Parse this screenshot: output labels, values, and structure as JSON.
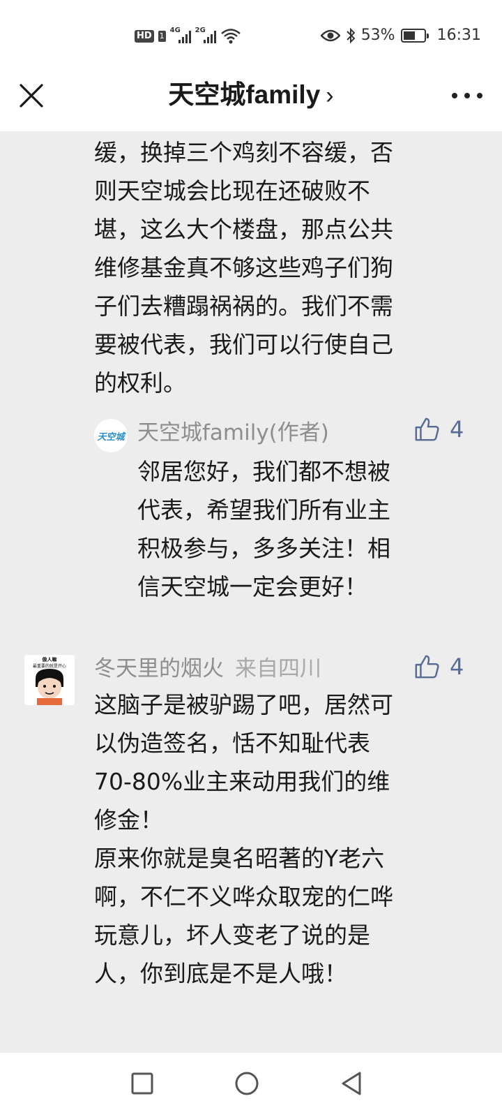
{
  "status_bar": {
    "hd": "HD",
    "sim": "1",
    "net1": "4G",
    "net2": "2G",
    "battery_pct": "53%",
    "time": "16:31",
    "icons": [
      "eye-icon",
      "bluetooth-icon",
      "battery-icon",
      "wifi-icon"
    ]
  },
  "header": {
    "title": "天空城family",
    "chevron": "›",
    "icons": [
      "close-icon",
      "more-icon"
    ]
  },
  "comment1": {
    "text": "缓，换掉三个鸡刻不容缓，否\n则天空城会比现在还破败不\n堪，这么大个楼盘，那点公共\n维修基金真不够这些鸡子们狗\n子们去糟蹋祸祸的。我们不需\n要被代表，我们可以行使自己\n的权利。"
  },
  "reply": {
    "avatar_text": "天空城",
    "author": "天空城family(作者)",
    "likes": "4",
    "text": "邻居您好，我们都不想被\n代表，希望我们所有业主\n积极参与，多多关注！相\n信天空城一定会更好！"
  },
  "comment2": {
    "avatar_caption_1": "做人嘛",
    "avatar_caption_2": "最重要的就是开心",
    "author": "冬天里的烟火",
    "location": "来自四川",
    "likes": "4",
    "text": "这脑子是被驴踢了吧，居然可\n以伪造签名，恬不知耻代表\n70-80%业主来动用我们的维\n修金！\n原来你就是臭名昭著的Y老六\n啊，不仁不义哗众取宠的仁哗\n玩意儿，坏人变老了说的是\n人，你到底是不是人哦！"
  },
  "colors": {
    "background": "#ededed",
    "link_blue": "#576b95",
    "meta_gray": "#8e8e8e"
  },
  "navbar": {
    "icons": [
      "square-icon",
      "circle-icon",
      "back-triangle-icon"
    ]
  }
}
